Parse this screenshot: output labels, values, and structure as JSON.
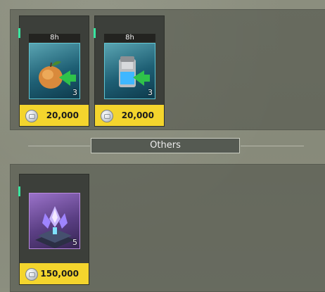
{
  "sections": [
    {
      "items": [
        {
          "timer": "8h",
          "quantity": "3",
          "price": "20,000",
          "icon": "fruit-icon",
          "rarity_color": "#5fc6d4"
        },
        {
          "timer": "8h",
          "quantity": "3",
          "price": "20,000",
          "icon": "canister-icon",
          "rarity_color": "#5fc6d4"
        }
      ]
    },
    {
      "title": "Others",
      "items": [
        {
          "quantity": "5",
          "price": "150,000",
          "icon": "crystal-platform-icon",
          "rarity_color": "#b98ae0"
        }
      ]
    }
  ],
  "currency_icon": "silver-coin-icon"
}
